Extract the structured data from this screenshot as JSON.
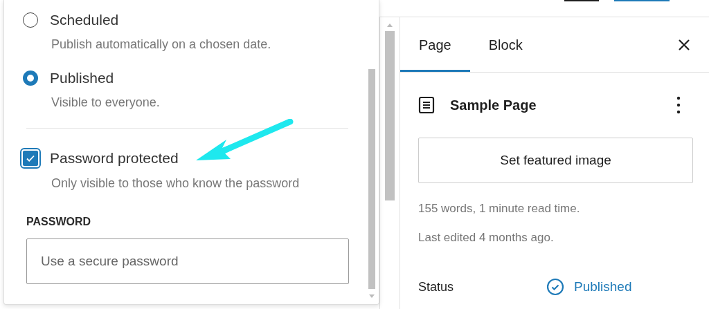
{
  "visibility_options": [
    {
      "kind": "radio",
      "label": "Scheduled",
      "description": "Publish automatically on a chosen date.",
      "selected": false
    },
    {
      "kind": "radio",
      "label": "Published",
      "description": "Visible to everyone.",
      "selected": true
    },
    {
      "kind": "checkbox",
      "label": "Password protected",
      "description": "Only visible to those who know the password",
      "checked": true
    }
  ],
  "password": {
    "label": "PASSWORD",
    "placeholder": "Use a secure password"
  },
  "sidebar": {
    "tabs": [
      {
        "label": "Page",
        "selected": true
      },
      {
        "label": "Block",
        "selected": false
      }
    ],
    "title": "Sample Page",
    "featured_button": "Set featured image",
    "stats": [
      "155 words, 1 minute read time.",
      "Last edited 4 months ago."
    ],
    "status": {
      "label": "Status",
      "value": "Published"
    }
  }
}
